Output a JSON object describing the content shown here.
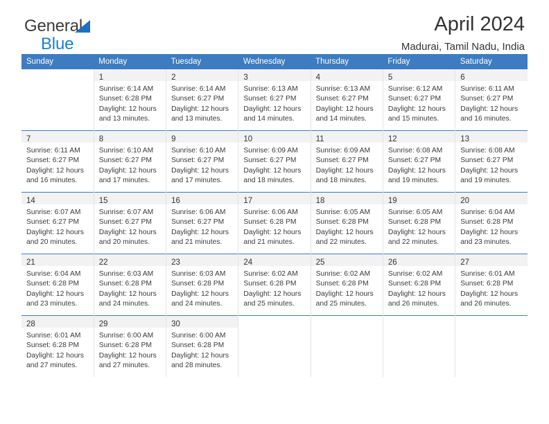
{
  "brand": {
    "name_part1": "General",
    "name_part2": "Blue",
    "triangle_color": "#1f6fc0",
    "text_color_part1": "#3b3b3b",
    "text_color_part2": "#1a7fd4"
  },
  "header": {
    "title": "April 2024",
    "subtitle": "Madurai, Tamil Nadu, India"
  },
  "calendar": {
    "header_bg": "#3d7cc0",
    "header_text_color": "#ffffff",
    "daynum_bar_bg": "#f2f2f2",
    "weekday_headers": [
      "Sunday",
      "Monday",
      "Tuesday",
      "Wednesday",
      "Thursday",
      "Friday",
      "Saturday"
    ],
    "weeks": [
      [
        {
          "day": "",
          "lines": []
        },
        {
          "day": "1",
          "lines": [
            "Sunrise: 6:14 AM",
            "Sunset: 6:28 PM",
            "Daylight: 12 hours",
            "and 13 minutes."
          ]
        },
        {
          "day": "2",
          "lines": [
            "Sunrise: 6:14 AM",
            "Sunset: 6:27 PM",
            "Daylight: 12 hours",
            "and 13 minutes."
          ]
        },
        {
          "day": "3",
          "lines": [
            "Sunrise: 6:13 AM",
            "Sunset: 6:27 PM",
            "Daylight: 12 hours",
            "and 14 minutes."
          ]
        },
        {
          "day": "4",
          "lines": [
            "Sunrise: 6:13 AM",
            "Sunset: 6:27 PM",
            "Daylight: 12 hours",
            "and 14 minutes."
          ]
        },
        {
          "day": "5",
          "lines": [
            "Sunrise: 6:12 AM",
            "Sunset: 6:27 PM",
            "Daylight: 12 hours",
            "and 15 minutes."
          ]
        },
        {
          "day": "6",
          "lines": [
            "Sunrise: 6:11 AM",
            "Sunset: 6:27 PM",
            "Daylight: 12 hours",
            "and 16 minutes."
          ]
        }
      ],
      [
        {
          "day": "7",
          "lines": [
            "Sunrise: 6:11 AM",
            "Sunset: 6:27 PM",
            "Daylight: 12 hours",
            "and 16 minutes."
          ]
        },
        {
          "day": "8",
          "lines": [
            "Sunrise: 6:10 AM",
            "Sunset: 6:27 PM",
            "Daylight: 12 hours",
            "and 17 minutes."
          ]
        },
        {
          "day": "9",
          "lines": [
            "Sunrise: 6:10 AM",
            "Sunset: 6:27 PM",
            "Daylight: 12 hours",
            "and 17 minutes."
          ]
        },
        {
          "day": "10",
          "lines": [
            "Sunrise: 6:09 AM",
            "Sunset: 6:27 PM",
            "Daylight: 12 hours",
            "and 18 minutes."
          ]
        },
        {
          "day": "11",
          "lines": [
            "Sunrise: 6:09 AM",
            "Sunset: 6:27 PM",
            "Daylight: 12 hours",
            "and 18 minutes."
          ]
        },
        {
          "day": "12",
          "lines": [
            "Sunrise: 6:08 AM",
            "Sunset: 6:27 PM",
            "Daylight: 12 hours",
            "and 19 minutes."
          ]
        },
        {
          "day": "13",
          "lines": [
            "Sunrise: 6:08 AM",
            "Sunset: 6:27 PM",
            "Daylight: 12 hours",
            "and 19 minutes."
          ]
        }
      ],
      [
        {
          "day": "14",
          "lines": [
            "Sunrise: 6:07 AM",
            "Sunset: 6:27 PM",
            "Daylight: 12 hours",
            "and 20 minutes."
          ]
        },
        {
          "day": "15",
          "lines": [
            "Sunrise: 6:07 AM",
            "Sunset: 6:27 PM",
            "Daylight: 12 hours",
            "and 20 minutes."
          ]
        },
        {
          "day": "16",
          "lines": [
            "Sunrise: 6:06 AM",
            "Sunset: 6:27 PM",
            "Daylight: 12 hours",
            "and 21 minutes."
          ]
        },
        {
          "day": "17",
          "lines": [
            "Sunrise: 6:06 AM",
            "Sunset: 6:28 PM",
            "Daylight: 12 hours",
            "and 21 minutes."
          ]
        },
        {
          "day": "18",
          "lines": [
            "Sunrise: 6:05 AM",
            "Sunset: 6:28 PM",
            "Daylight: 12 hours",
            "and 22 minutes."
          ]
        },
        {
          "day": "19",
          "lines": [
            "Sunrise: 6:05 AM",
            "Sunset: 6:28 PM",
            "Daylight: 12 hours",
            "and 22 minutes."
          ]
        },
        {
          "day": "20",
          "lines": [
            "Sunrise: 6:04 AM",
            "Sunset: 6:28 PM",
            "Daylight: 12 hours",
            "and 23 minutes."
          ]
        }
      ],
      [
        {
          "day": "21",
          "lines": [
            "Sunrise: 6:04 AM",
            "Sunset: 6:28 PM",
            "Daylight: 12 hours",
            "and 23 minutes."
          ]
        },
        {
          "day": "22",
          "lines": [
            "Sunrise: 6:03 AM",
            "Sunset: 6:28 PM",
            "Daylight: 12 hours",
            "and 24 minutes."
          ]
        },
        {
          "day": "23",
          "lines": [
            "Sunrise: 6:03 AM",
            "Sunset: 6:28 PM",
            "Daylight: 12 hours",
            "and 24 minutes."
          ]
        },
        {
          "day": "24",
          "lines": [
            "Sunrise: 6:02 AM",
            "Sunset: 6:28 PM",
            "Daylight: 12 hours",
            "and 25 minutes."
          ]
        },
        {
          "day": "25",
          "lines": [
            "Sunrise: 6:02 AM",
            "Sunset: 6:28 PM",
            "Daylight: 12 hours",
            "and 25 minutes."
          ]
        },
        {
          "day": "26",
          "lines": [
            "Sunrise: 6:02 AM",
            "Sunset: 6:28 PM",
            "Daylight: 12 hours",
            "and 26 minutes."
          ]
        },
        {
          "day": "27",
          "lines": [
            "Sunrise: 6:01 AM",
            "Sunset: 6:28 PM",
            "Daylight: 12 hours",
            "and 26 minutes."
          ]
        }
      ],
      [
        {
          "day": "28",
          "lines": [
            "Sunrise: 6:01 AM",
            "Sunset: 6:28 PM",
            "Daylight: 12 hours",
            "and 27 minutes."
          ]
        },
        {
          "day": "29",
          "lines": [
            "Sunrise: 6:00 AM",
            "Sunset: 6:28 PM",
            "Daylight: 12 hours",
            "and 27 minutes."
          ]
        },
        {
          "day": "30",
          "lines": [
            "Sunrise: 6:00 AM",
            "Sunset: 6:28 PM",
            "Daylight: 12 hours",
            "and 28 minutes."
          ]
        },
        {
          "day": "",
          "lines": []
        },
        {
          "day": "",
          "lines": []
        },
        {
          "day": "",
          "lines": []
        },
        {
          "day": "",
          "lines": []
        }
      ]
    ]
  }
}
